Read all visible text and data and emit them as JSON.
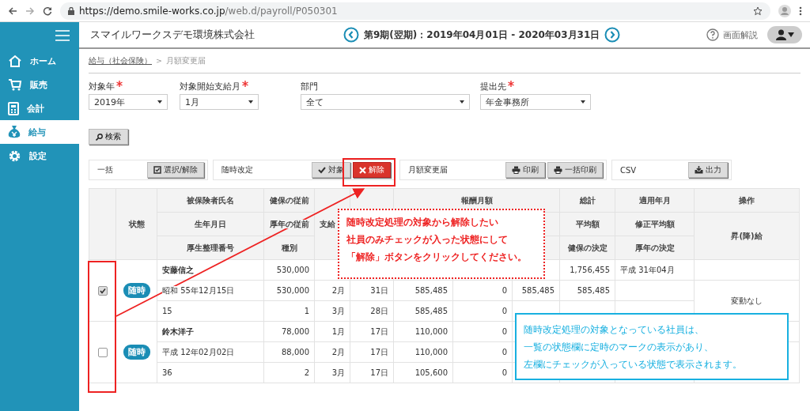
{
  "browser": {
    "url_host": "https://demo.smile-works.co.jp",
    "url_path": "/web.d/payroll/P050301"
  },
  "sidebar": {
    "items": [
      {
        "label": "ホーム",
        "selected": false
      },
      {
        "label": "販売",
        "selected": false
      },
      {
        "label": "会計",
        "selected": false
      },
      {
        "label": "給与",
        "selected": true
      },
      {
        "label": "設定",
        "selected": false
      }
    ]
  },
  "header": {
    "company": "スマイルワークスデモ環境株式会社",
    "period": "第9期(翌期)：2019年04月01日 - 2020年03月31日",
    "help": "画面解説"
  },
  "breadcrumb": {
    "items": [
      "給与（社会保険）",
      "月額変更届"
    ],
    "separator": ">"
  },
  "filters": [
    {
      "label": "対象年",
      "required": true,
      "value": "2019年"
    },
    {
      "label": "対象開始支給月",
      "required": true,
      "value": "1月"
    },
    {
      "label": "部門",
      "required": false,
      "value": "全て"
    },
    {
      "label": "提出先",
      "required": true,
      "value": "年金事務所"
    }
  ],
  "search_button": "検索",
  "action_groups": [
    {
      "label": "一括",
      "buttons": [
        {
          "label": "選択/解除",
          "kind": "toggle"
        }
      ]
    },
    {
      "label": "随時改定",
      "buttons": [
        {
          "label": "対象",
          "kind": "confirm"
        },
        {
          "label": "解除",
          "kind": "cancel"
        }
      ]
    },
    {
      "label": "月額変更届",
      "buttons": [
        {
          "label": "印刷",
          "kind": "print"
        },
        {
          "label": "一括印刷",
          "kind": "print"
        }
      ]
    },
    {
      "label": "CSV",
      "buttons": [
        {
          "label": "出力",
          "kind": "export"
        }
      ]
    }
  ],
  "table": {
    "header": {
      "status": "状態",
      "pay_month": "支給",
      "remuneration": "報酬月額",
      "name_column": [
        "被保険者氏名",
        "生年月日",
        "厚生整理番号"
      ],
      "prior_column": [
        "健保の従前",
        "厚年の従前",
        "種別"
      ],
      "total_column": [
        "総計",
        "平均額",
        "健保の決定"
      ],
      "apply_column": [
        "適用年月",
        "修正平均額",
        "厚年の決定"
      ],
      "operation_column": [
        "操作",
        "昇(降)給"
      ]
    },
    "employees": [
      {
        "checked": true,
        "status": "随時",
        "operation": "変動なし",
        "rows": [
          [
            "安藤信之",
            "530,000",
            null,
            null,
            null,
            null,
            null,
            "1,756,455",
            "平成 31年04月"
          ],
          [
            "昭和 55年12月15日",
            "530,000",
            "2月",
            "31日",
            "585,485",
            "0",
            "585,485",
            "585,485",
            null
          ],
          [
            "15",
            "1",
            "3月",
            "28日",
            "585,485",
            "0",
            null,
            null,
            null
          ]
        ]
      },
      {
        "checked": false,
        "status": "随時",
        "rows": [
          [
            "鈴木洋子",
            "78,000",
            "1月",
            "17日",
            "110,000",
            "0",
            null,
            null,
            null
          ],
          [
            "平成 12年02月02日",
            "88,000",
            "2月",
            "17日",
            "110,000",
            "0",
            null,
            null,
            null
          ],
          [
            "36",
            "2",
            "3月",
            "17日",
            "105,600",
            "0",
            null,
            null,
            null
          ]
        ]
      }
    ]
  },
  "callouts": [
    {
      "kind": "warning",
      "lines": [
        "随時改定処理の対象から解除したい",
        "社員のみチェックが入った状態にして",
        "「解除」ボタンをクリックしてください。"
      ]
    },
    {
      "kind": "info",
      "lines": [
        "随時改定処理の対象となっている社員は、",
        "一覧の状態欄に定時のマークの表示があり、",
        "左欄にチェックが入っている状態で表示されます。"
      ]
    }
  ]
}
